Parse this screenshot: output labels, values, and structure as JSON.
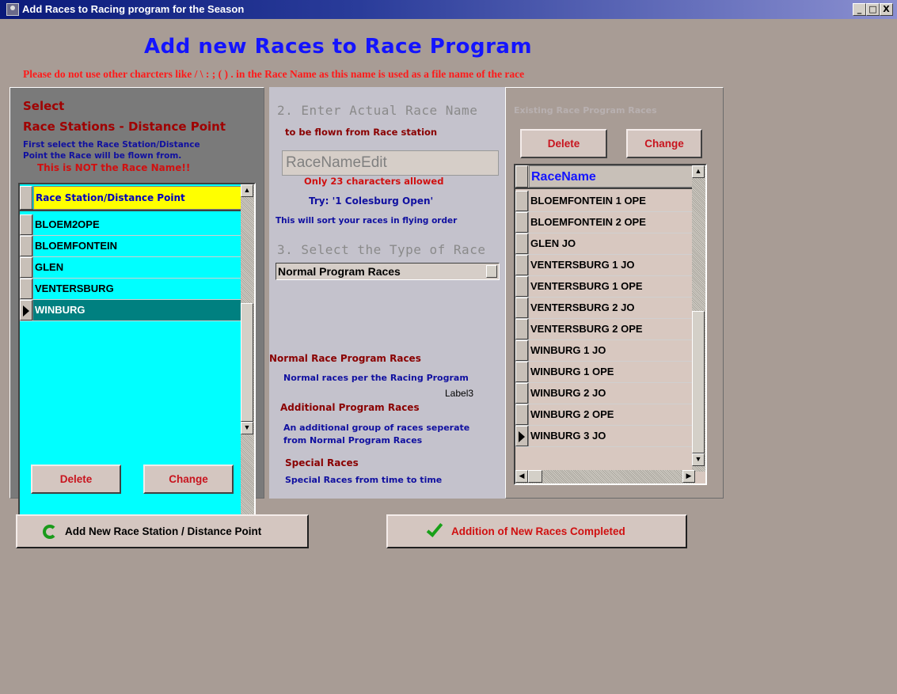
{
  "window": {
    "title": "Add Races to Racing program for the Season",
    "buttons": [
      "_",
      "□",
      "X"
    ]
  },
  "heading": "Add new Races to Race Program",
  "warning": "Please do not use other charcters like / \\ : ; ( ) . in the Race Name as this name is used as a file name of the race",
  "left": {
    "select": "Select",
    "stations_heading": "Race Stations - Distance Point",
    "help1": "First select the Race Station/Distance",
    "help2": "Point the Race will be flown from.",
    "not_name": "This is NOT the Race Name!!",
    "header": "Race Station/Distance Point",
    "rows": [
      "BLOEM2OPE",
      "BLOEMFONTEIN",
      "GLEN",
      "VENTERSBURG",
      "WINBURG"
    ],
    "selected_row": "WINBURG",
    "delete": "Delete",
    "change": "Change"
  },
  "mid": {
    "step2": "2.  Enter Actual Race Name",
    "step2_sub": "to be flown from Race station",
    "edit_value": "RaceNameEdit",
    "limit": "Only 23 characters allowed",
    "try": "Try: '1 Colesburg Open'",
    "sort_note": "This will sort your races in flying order",
    "step3": "3.  Select the Type of Race",
    "race_type": "Normal Program Races",
    "normal_title": "Normal Race Program Races",
    "normal_desc": "Normal races per the Racing Program",
    "label3": "Label3",
    "additional_title": "Additional Program Races",
    "additional_desc1": "An additional group of races seperate",
    "additional_desc2": "from Normal Program Races",
    "special_title": "Special Races",
    "special_desc": "Special Races from time to time"
  },
  "right": {
    "title": "Existing Race Program Races",
    "delete": "Delete",
    "change": "Change",
    "header": "RaceName",
    "rows": [
      "BLOEMFONTEIN 1 OPE",
      "BLOEMFONTEIN 2 OPE",
      "GLEN JO",
      "VENTERSBURG 1 JO",
      "VENTERSBURG 1 OPE",
      "VENTERSBURG 2 JO",
      "VENTERSBURG 2 OPE",
      "WINBURG 1 JO",
      "WINBURG 1 OPE",
      "WINBURG 2 JO",
      "WINBURG 2 OPE",
      "WINBURG 3 JO"
    ],
    "selected_row": "WINBURG 3 JO"
  },
  "bottom": {
    "add_station": "Add New Race Station / Distance Point",
    "completed": "Addition of New Races Completed"
  }
}
